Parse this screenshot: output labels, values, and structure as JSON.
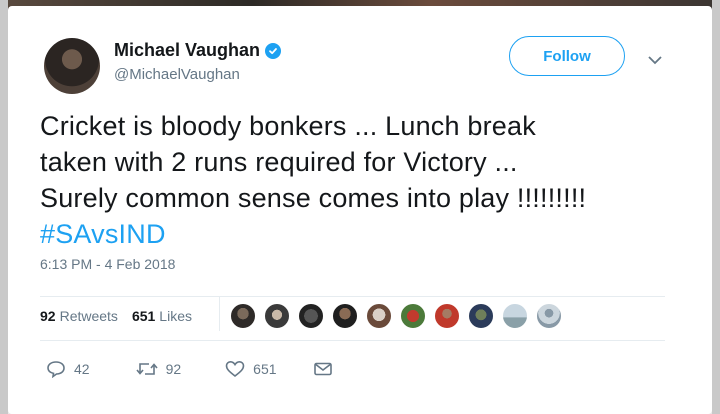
{
  "tweet": {
    "author_name": "Michael Vaughan",
    "author_handle": "@MichaelVaughan",
    "follow_label": "Follow",
    "text_line1": "Cricket is bloody bonkers ... Lunch break",
    "text_line2": "taken with 2 runs required for Victory ...",
    "text_line3": "Surely common sense comes into play !!!!!!!!!",
    "hashtag": "#SAvsIND",
    "timestamp": "6:13 PM - 4 Feb 2018"
  },
  "stats": {
    "retweets_count": "92",
    "retweets_label": "Retweets",
    "likes_count": "651",
    "likes_label": "Likes"
  },
  "likers": [
    "avatar",
    "avatar",
    "avatar",
    "avatar",
    "avatar",
    "avatar",
    "avatar",
    "avatar",
    "avatar",
    "avatar"
  ],
  "actions": {
    "reply_count": "42",
    "retweet_count": "92",
    "like_count": "651"
  },
  "colors": {
    "accent": "#1da1f2",
    "text": "#14171a",
    "muted": "#657786"
  },
  "icons": [
    "verified-icon",
    "chevron-down-icon",
    "reply-icon",
    "retweet-icon",
    "like-icon",
    "message-icon"
  ]
}
